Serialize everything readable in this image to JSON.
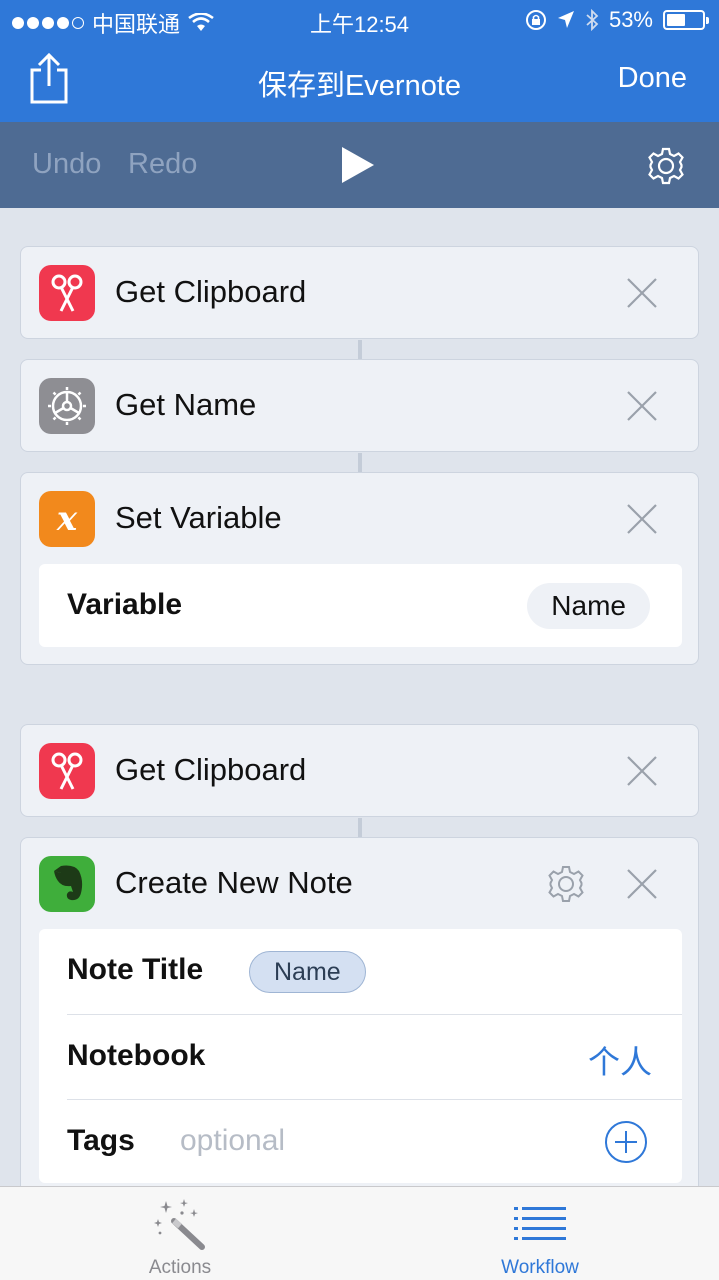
{
  "status_bar": {
    "carrier": "中国联通",
    "time": "上午12:54",
    "battery": "53%",
    "battery_level": 0.53,
    "signal_bars": 4,
    "signal_max": 5
  },
  "nav": {
    "title": "保存到Evernote",
    "done_label": "Done",
    "share_icon": "share-icon"
  },
  "toolbar": {
    "undo_label": "Undo",
    "redo_label": "Redo",
    "play_icon": "play-icon",
    "settings_icon": "gear-icon"
  },
  "actions": [
    {
      "title": "Get Clipboard",
      "icon": "scissors-icon",
      "icon_color": "#f0384f"
    },
    {
      "title": "Get Name",
      "icon": "gear-icon",
      "icon_color": "#8e8e93"
    },
    {
      "title": "Set Variable",
      "icon": "variable-x-icon",
      "icon_color": "#f2891c",
      "params": [
        {
          "label": "Variable",
          "value": "Name"
        }
      ]
    },
    {
      "title": "Get Clipboard",
      "icon": "scissors-icon",
      "icon_color": "#f0384f"
    },
    {
      "title": "Create New Note",
      "icon": "evernote-icon",
      "icon_color": "#3fae3b",
      "params": [
        {
          "label": "Note Title",
          "value": "Name"
        },
        {
          "label": "Notebook",
          "value": "个人"
        },
        {
          "label": "Tags",
          "placeholder": "optional"
        }
      ]
    }
  ],
  "tabbar": {
    "tabs": [
      {
        "label": "Actions",
        "icon": "magic-wand-icon",
        "selected": false
      },
      {
        "label": "Workflow",
        "icon": "list-icon",
        "selected": true
      }
    ]
  },
  "colors": {
    "nav_blue": "#2f78d8",
    "toolbar_blue": "#4e6b93",
    "background": "#dfe4ec",
    "accent": "#2f78d8"
  }
}
